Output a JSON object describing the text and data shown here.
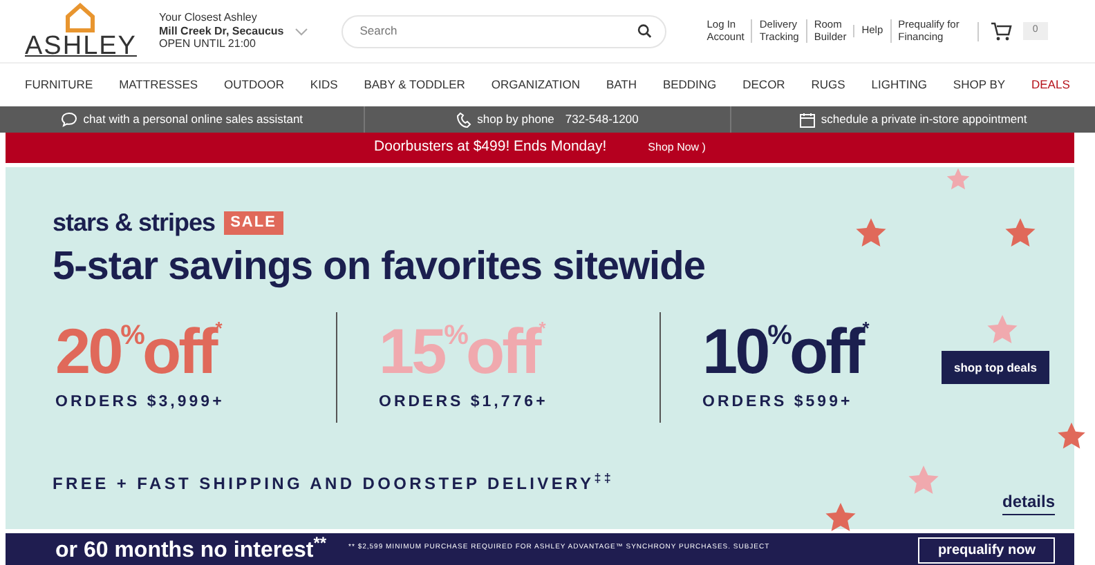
{
  "header": {
    "logo": "ASHLEY",
    "store": {
      "label": "Your Closest Ashley",
      "name": "Mill Creek Dr, Secaucus",
      "hours": "OPEN UNTIL 21:00"
    },
    "search": {
      "placeholder": "Search"
    },
    "links": [
      {
        "line1": "Log In",
        "line2": "Account"
      },
      {
        "line1": "Delivery",
        "line2": "Tracking"
      },
      {
        "line1": "Room",
        "line2": "Builder"
      },
      {
        "line1": "Help"
      },
      {
        "line1": "Prequalify for",
        "line2": "Financing"
      }
    ],
    "cart_count": "0"
  },
  "nav": [
    {
      "label": "FURNITURE",
      "kind": "normal"
    },
    {
      "label": "MATTRESSES",
      "kind": "normal"
    },
    {
      "label": "OUTDOOR",
      "kind": "normal"
    },
    {
      "label": "KIDS",
      "kind": "normal"
    },
    {
      "label": "BABY & TODDLER",
      "kind": "normal"
    },
    {
      "label": "ORGANIZATION",
      "kind": "normal"
    },
    {
      "label": "BATH",
      "kind": "normal"
    },
    {
      "label": "BEDDING",
      "kind": "normal"
    },
    {
      "label": "DECOR",
      "kind": "normal"
    },
    {
      "label": "RUGS",
      "kind": "normal"
    },
    {
      "label": "LIGHTING",
      "kind": "normal"
    },
    {
      "label": "SHOP BY",
      "kind": "normal"
    },
    {
      "label": "DEALS",
      "kind": "deal"
    }
  ],
  "service_bar": [
    {
      "kind": "chat",
      "text": "chat with a personal online sales assistant"
    },
    {
      "kind": "phone",
      "text": "shop by phone",
      "extra": "732-548-1200"
    },
    {
      "kind": "calendar",
      "text": "schedule a private in-store appointment"
    }
  ],
  "alert": {
    "text": "Doorbusters at $499! Ends Monday!",
    "link": "Shop Now )"
  },
  "promo": {
    "brand": "stars & stripes",
    "tag": "SALE",
    "headline": "5-star savings on favorites sitewide",
    "offers": [
      {
        "percent": "20",
        "sign": "%",
        "off": "off",
        "mark": "*",
        "orders": "ORDERS $3,999+",
        "color": "#e0695a"
      },
      {
        "percent": "15",
        "sign": "%",
        "off": "off",
        "mark": "*",
        "orders": "ORDERS $1,776+",
        "color": "#f0a9ae"
      },
      {
        "percent": "10",
        "sign": "%",
        "off": "off",
        "mark": "*",
        "orders": "ORDERS $599+",
        "color": "#1b1f4f"
      }
    ],
    "button": "shop top deals",
    "shipping": "FREE + FAST SHIPPING AND DOORSTEP DELIVERY$^{‡‡}$",
    "details": "details"
  },
  "financing": {
    "headline": "or 60 months no interest$^{**}$",
    "fine_print": "** $2,599 MINIMUM PURCHASE REQUIRED FOR ASHLEY ADVANTAGE™ SYNCHRONY PURCHASES. SUBJECT",
    "button": "prequalify now"
  }
}
